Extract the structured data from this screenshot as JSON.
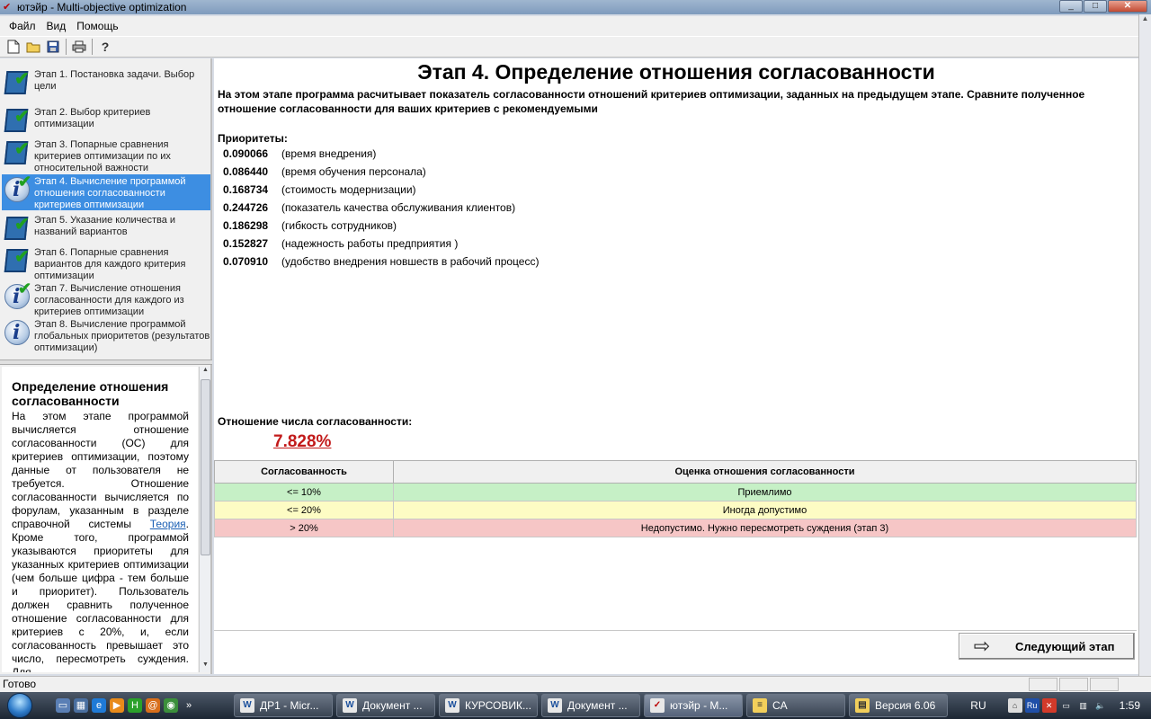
{
  "window": {
    "title": "ютэйр - Multi-objective optimization",
    "min": "_",
    "max": "□",
    "close": "✕"
  },
  "menu": [
    "Файл",
    "Вид",
    "Помощь"
  ],
  "steps": [
    {
      "label": "Этап 1. Постановка задачи. Выбор цели",
      "icon": "check"
    },
    {
      "label": "Этап 2. Выбор критериев оптимизации",
      "icon": "check"
    },
    {
      "label": "Этап 3. Попарные сравнения критериев оптимизации по их относительной важности",
      "icon": "check"
    },
    {
      "label": "Этап 4. Вычисление программой отношения согласованности критериев оптимизации",
      "icon": "info",
      "active": true
    },
    {
      "label": "Этап 5. Указание количества и названий вариантов",
      "icon": "check"
    },
    {
      "label": "Этап 6. Попарные сравнения вариантов для каждого критерия оптимизации",
      "icon": "check"
    },
    {
      "label": "Этап 7. Вычисление отношения согласованности для каждого из критериев оптимизации",
      "icon": "info"
    },
    {
      "label": "Этап 8. Вычисление программой глобальных приоритетов (результатов оптимизации)",
      "icon": "info"
    }
  ],
  "help": {
    "title": "Определение отношения согласованности",
    "text_before_link": "На этом этапе программой вычисляется отношение согласованности (ОС) для критериев оптимизации, поэтому данные от пользователя не требуется. Отношение согласованности вычисляется по форулам, указанным в разделе справочной системы ",
    "link": "Теория",
    "text_after_link": ". Кроме того, программой указываются приоритеты для указанных критериев оптимизации (чем больше цифра - тем больше и приоритет). Пользователь должен сравнить полученное отношение согласованности для критериев с 20%, и, если согласованность превышает это число, пересмотреть суждения. Для"
  },
  "main": {
    "heading": "Этап 4. Определение отношения согласованности",
    "intro": "На этом этапе программа расчитывает показатель согласованности отношений критериев оптимизации, заданных на предыдущем этапе. Сравните полученное отношение согласованности для ваших критериев с рекомендуемыми",
    "priorities_title": "Приоритеты:",
    "priorities": [
      {
        "value": "0.090066",
        "name": "(время внедрения)"
      },
      {
        "value": "0.086440",
        "name": "(время обучения персонала)"
      },
      {
        "value": "0.168734",
        "name": "(стоимость модернизации)"
      },
      {
        "value": "0.244726",
        "name": "(показатель качества обслуживания клиентов)"
      },
      {
        "value": "0.186298",
        "name": "(гибкость сотрудников)"
      },
      {
        "value": "0.152827",
        "name": "(надежность работы предприятия )"
      },
      {
        "value": "0.070910",
        "name": "(удобство внедрения новшеств в рабочий процесс)"
      }
    ],
    "ratio_title": "Отношение числа согласованности:",
    "ratio_value": "7.828%",
    "table": {
      "headers": [
        "Согласованность",
        "Оценка отношения согласованности"
      ],
      "rows": [
        {
          "range": "<= 10%",
          "rating": "Приемлимо",
          "color": "#c6f0c6"
        },
        {
          "range": "<= 20%",
          "rating": "Иногда допустимо",
          "color": "#fdfcc4"
        },
        {
          "range": "> 20%",
          "rating": "Недопустимо. Нужно пересмотреть суждения (этап 3)",
          "color": "#f6c6c6"
        }
      ]
    },
    "next_button": "Следующий этап"
  },
  "status": "Готово",
  "taskbar": {
    "tasks": [
      {
        "label": "ДР1 - Micr...",
        "icon": "W"
      },
      {
        "label": "Документ ...",
        "icon": "W"
      },
      {
        "label": "КУРСОВИК...",
        "icon": "W"
      },
      {
        "label": "Документ ...",
        "icon": "W"
      },
      {
        "label": "ютэйр - M...",
        "icon": "✓",
        "active": true
      },
      {
        "label": "CA",
        "icon": "≡"
      },
      {
        "label": "Версия 6.06",
        "icon": "▤"
      }
    ],
    "lang": "RU",
    "clock": "1:59"
  }
}
